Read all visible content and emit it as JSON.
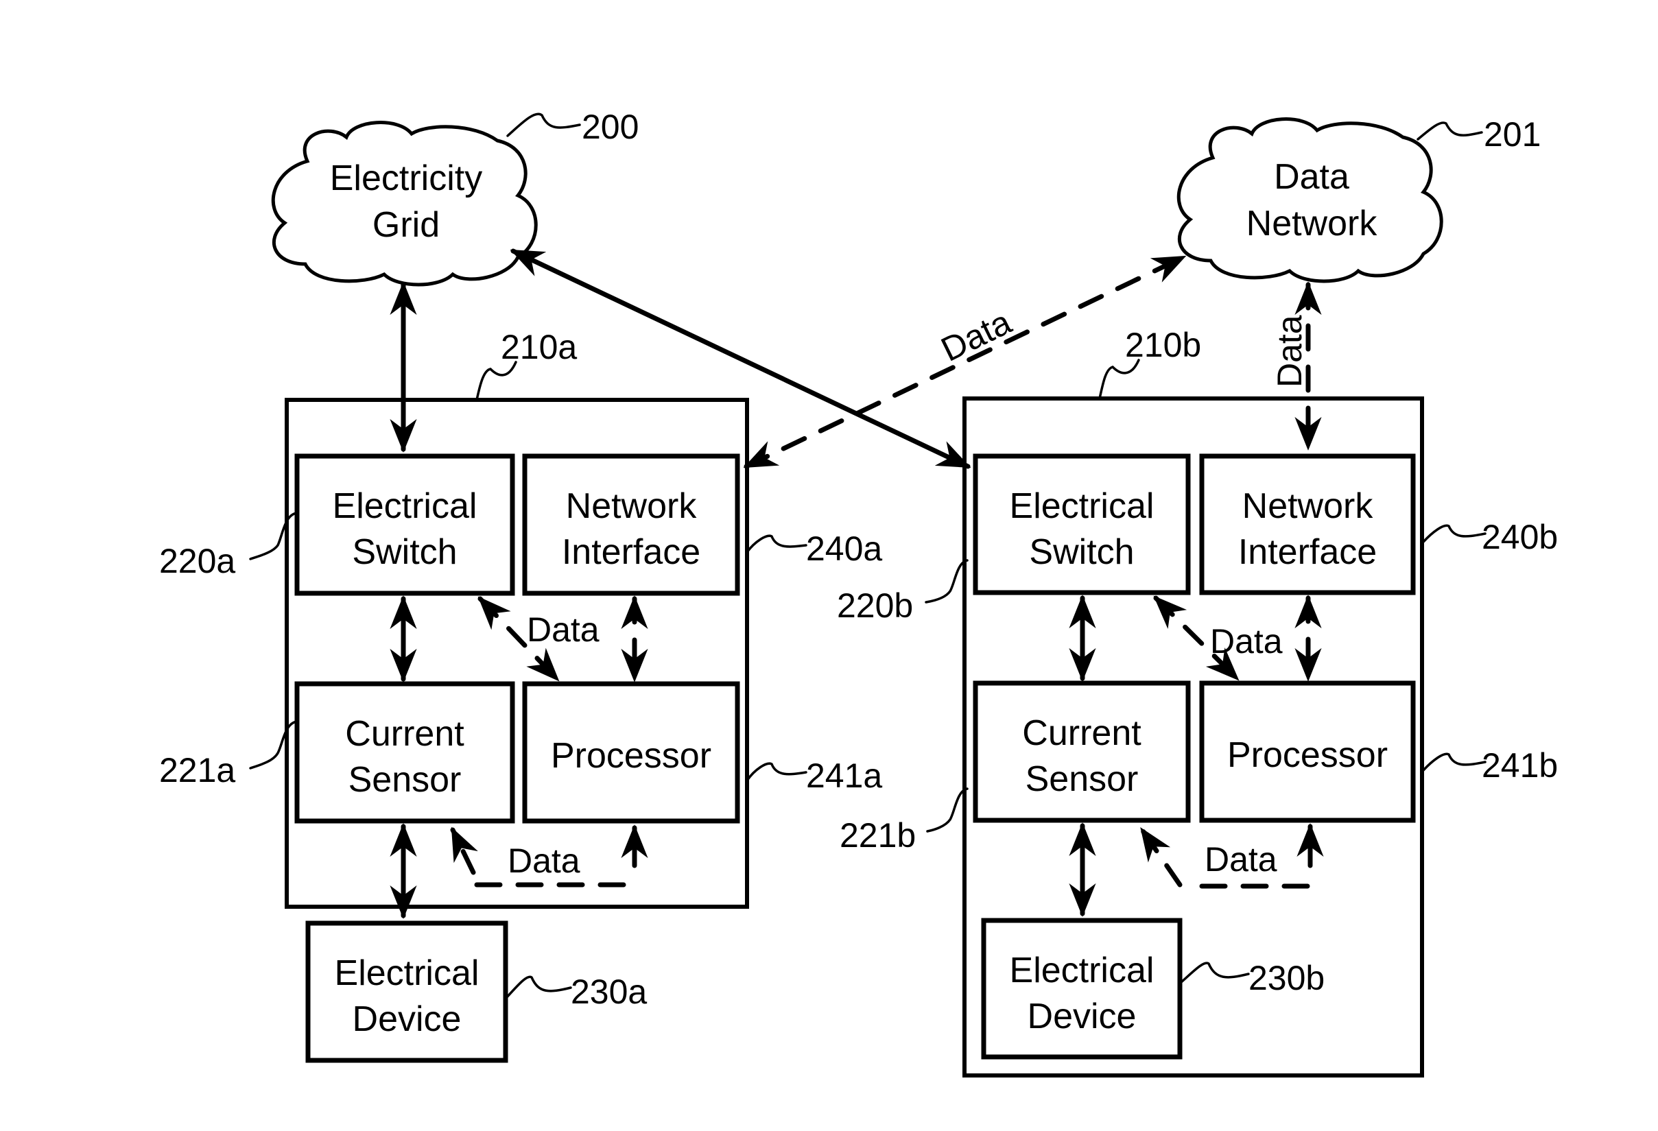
{
  "figure": {
    "clouds": [
      {
        "id": "electricity-grid",
        "lines": [
          "Electricity",
          "Grid"
        ],
        "ref": "200"
      },
      {
        "id": "data-network",
        "lines": [
          "Data",
          "Network"
        ],
        "ref": "201"
      }
    ],
    "systems": [
      {
        "ref": "210a",
        "electrical_switch": {
          "lines": [
            "Electrical",
            "Switch"
          ],
          "ref": "220a"
        },
        "network_interface": {
          "lines": [
            "Network",
            "Interface"
          ],
          "ref": "240a"
        },
        "current_sensor": {
          "lines": [
            "Current",
            "Sensor"
          ],
          "ref": "221a"
        },
        "processor": {
          "lines": [
            "Processor"
          ],
          "ref": "241a"
        },
        "electrical_device": {
          "lines": [
            "Electrical",
            "Device"
          ],
          "ref": "230a"
        },
        "data_labels": [
          "Data",
          "Data"
        ]
      },
      {
        "ref": "210b",
        "electrical_switch": {
          "lines": [
            "Electrical",
            "Switch"
          ],
          "ref": "220b"
        },
        "network_interface": {
          "lines": [
            "Network",
            "Interface"
          ],
          "ref": "240b"
        },
        "current_sensor": {
          "lines": [
            "Current",
            "Sensor"
          ],
          "ref": "221b"
        },
        "processor": {
          "lines": [
            "Processor"
          ],
          "ref": "241b"
        },
        "electrical_device": {
          "lines": [
            "Electrical",
            "Device"
          ],
          "ref": "230b"
        },
        "data_labels": [
          "Data",
          "Data"
        ]
      }
    ],
    "links": {
      "network_a_to_data_network_label": "Data",
      "network_b_to_data_network_label": "Data"
    }
  }
}
